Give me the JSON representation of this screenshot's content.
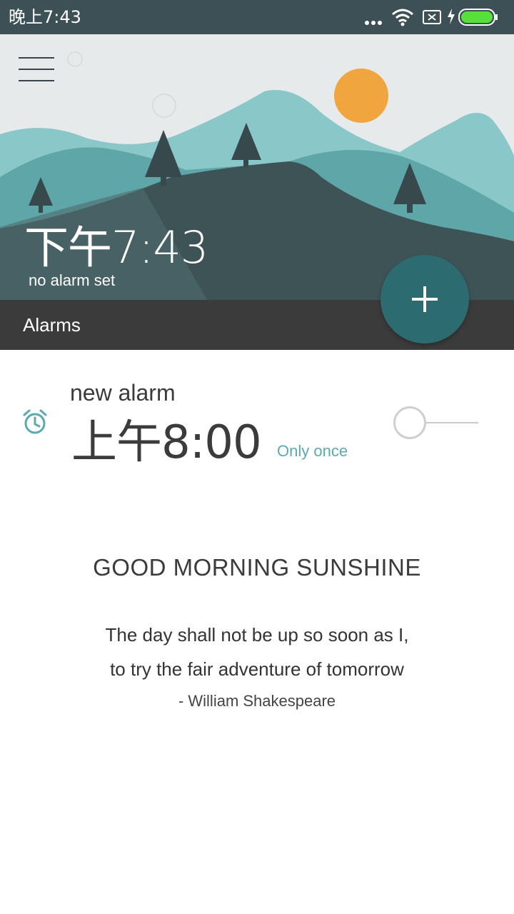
{
  "status_bar": {
    "time": "晚上7:43",
    "icons": [
      "more-dots-icon",
      "wifi-icon",
      "sim-off-icon",
      "charging-icon",
      "battery-icon"
    ],
    "battery_color": "#58e03a"
  },
  "header": {
    "current_time": "下午7:43",
    "alarm_status": "no alarm set",
    "sun_color": "#f1a53f"
  },
  "tabs": {
    "alarms_label": "Alarms"
  },
  "fab": {
    "icon": "plus-icon",
    "color": "#2c6b70"
  },
  "alarms": [
    {
      "name": "new alarm",
      "time": "上午8:00",
      "repeat": "Only once",
      "enabled": false,
      "icon": "alarm-clock-icon"
    }
  ],
  "quote": {
    "title": "GOOD MORNING SUNSHINE",
    "line1": "The day shall not be up so soon as I,",
    "line2": "to try the fair adventure of tomorrow",
    "author": "- William Shakespeare"
  },
  "colors": {
    "status_bar": "#3d5056",
    "tab_strip": "#3b3b3b",
    "accent": "#5aaab0"
  }
}
